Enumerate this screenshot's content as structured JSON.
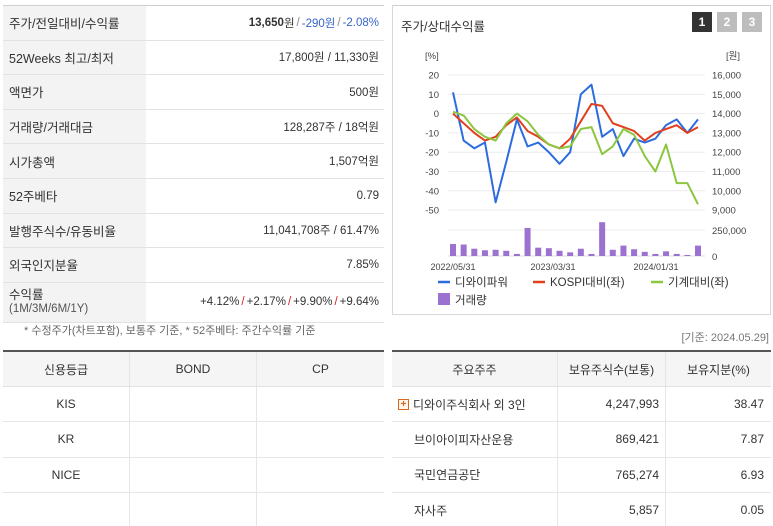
{
  "summary": {
    "rows": [
      {
        "label": "주가/전일대비/수익률",
        "price": "13,650",
        "unit": "원",
        "change": "-290원",
        "rate": "-2.08%"
      },
      {
        "label": "52Weeks 최고/최저",
        "value": "17,800원 / 11,330원"
      },
      {
        "label": "액면가",
        "value": "500원"
      },
      {
        "label": "거래량/거래대금",
        "value": "128,287주 / 18억원"
      },
      {
        "label": "시가총액",
        "value": "1,507억원"
      },
      {
        "label": "52주베타",
        "value": "0.79"
      },
      {
        "label": "발행주식수/유동비율",
        "value": "11,041,708주 / 61.47%"
      },
      {
        "label": "외국인지분율",
        "value": "7.85%"
      }
    ],
    "returns": {
      "label": "수익률",
      "sub": "(1M/3M/6M/1Y)",
      "r1": "+4.12%",
      "r2": "+2.17%",
      "r3": "+9.90%",
      "r4": "+9.64%"
    },
    "note": "* 수정주가(차트포함), 보통주 기준, * 52주베타: 주간수익률 기준",
    "as_of": "[기준: 2024.05.29]"
  },
  "chart_panel": {
    "title": "주가/상대수익률",
    "pages": [
      "1",
      "2",
      "3"
    ]
  },
  "chart_data": {
    "type": "line",
    "left_unit": "[%]",
    "right_unit": "[원]",
    "left_ticks": [
      "20",
      "10",
      "0",
      "-10",
      "-20",
      "-30",
      "-40",
      "-50"
    ],
    "right_ticks": [
      "16,000",
      "15,000",
      "14,000",
      "13,000",
      "12,000",
      "11,000",
      "10,000",
      "9,000"
    ],
    "volume_ticks": [
      "250,000",
      "0"
    ],
    "x_ticks": [
      "2022/05/31",
      "2023/03/31",
      "2024/01/31"
    ],
    "ylim_left": [
      -50,
      20
    ],
    "series": [
      {
        "name": "디와이파워",
        "color": "#2d6cdf",
        "values": [
          11,
          -14,
          -18,
          -15,
          -46,
          -25,
          -3,
          -17,
          -15,
          -20,
          -26,
          -20,
          10,
          15,
          -12,
          -8,
          -22,
          -13,
          -15,
          -13,
          -6,
          -3,
          -10,
          -3
        ]
      },
      {
        "name": "KOSPI대비(좌)",
        "color": "#e0401d",
        "values": [
          0,
          -5,
          -10,
          -14,
          -12,
          -6,
          -2,
          -9,
          -12,
          -16,
          -18,
          -13,
          -4,
          5,
          4,
          -5,
          -7,
          -9,
          -14,
          -10,
          -8,
          -6,
          -10,
          -7
        ]
      },
      {
        "name": "기계대비(좌)",
        "color": "#8cc63f",
        "values": [
          1,
          -1,
          -8,
          -12,
          -14,
          -5,
          0,
          -4,
          -11,
          -16,
          -18,
          -17,
          -8,
          -7,
          -21,
          -17,
          -8,
          -11,
          -22,
          -30,
          -16,
          -36,
          -36,
          -47
        ]
      }
    ],
    "volume": {
      "name": "거래량",
      "color": "#9b72cf",
      "values": [
        115000,
        110000,
        70000,
        55000,
        60000,
        50000,
        20000,
        270000,
        80000,
        75000,
        50000,
        35000,
        70000,
        20000,
        330000,
        60000,
        100000,
        65000,
        40000,
        20000,
        45000,
        20000,
        10000,
        100000
      ]
    }
  },
  "credit": {
    "headers": [
      "신용등급",
      "BOND",
      "CP"
    ],
    "rows": [
      [
        "KIS",
        "",
        ""
      ],
      [
        "KR",
        "",
        ""
      ],
      [
        "NICE",
        "",
        ""
      ],
      [
        "",
        "",
        ""
      ]
    ]
  },
  "holders": {
    "headers": [
      "주요주주",
      "보유주식수(보통)",
      "보유지분(%)"
    ],
    "rows": [
      {
        "name": "디와이주식회사 외 3인",
        "shares": "4,247,993",
        "pct": "38.47",
        "expandable": true
      },
      {
        "name": "브이아이피자산운용",
        "shares": "869,421",
        "pct": "7.87",
        "expandable": false
      },
      {
        "name": "국민연금공단",
        "shares": "765,274",
        "pct": "6.93",
        "expandable": false
      },
      {
        "name": "자사주",
        "shares": "5,857",
        "pct": "0.05",
        "expandable": false
      }
    ]
  }
}
